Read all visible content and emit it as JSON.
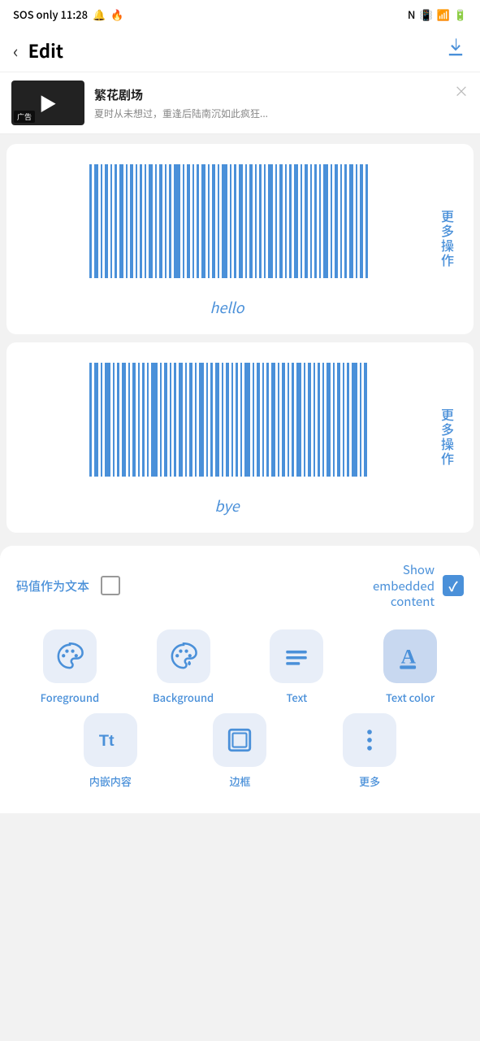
{
  "statusBar": {
    "left": "SOS only  11:28",
    "bell_icon": "bell",
    "flame_icon": "flame"
  },
  "header": {
    "back_label": "‹",
    "title": "Edit",
    "download_label": "⬇"
  },
  "ad": {
    "title": "繁花剧场",
    "subtitle": "夏时从未想过，重逢后陆南沉如此疯狂...",
    "thumb_label": "广告",
    "close_label": "×"
  },
  "barcodes": [
    {
      "label": "hello",
      "more_actions": "更多操作"
    },
    {
      "label": "bye",
      "more_actions": "更多操作"
    }
  ],
  "bottomSheet": {
    "code_as_text_label": "码值作为文本",
    "checkbox_checked": false,
    "show_embedded_label": "Show\nembedded\ncontent",
    "embedded_checked": true
  },
  "tools": [
    {
      "id": "foreground",
      "label": "Foreground",
      "icon": "palette"
    },
    {
      "id": "background",
      "label": "Background",
      "icon": "palette2"
    },
    {
      "id": "text",
      "label": "Text",
      "icon": "text-align"
    },
    {
      "id": "text-color",
      "label": "Text color",
      "icon": "font-color",
      "active": true
    }
  ],
  "tools2": [
    {
      "id": "embedded",
      "label": "内嵌内容",
      "icon": "tt"
    },
    {
      "id": "border",
      "label": "边框",
      "icon": "border"
    },
    {
      "id": "more",
      "label": "更多",
      "icon": "dots"
    }
  ]
}
